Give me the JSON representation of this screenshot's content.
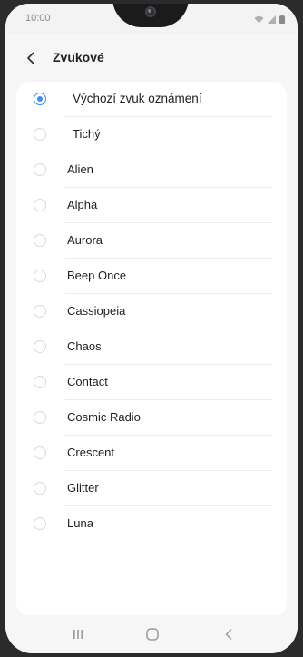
{
  "status_bar": {
    "time": "10:00"
  },
  "header": {
    "title": "Zvukové",
    "back_icon": "chevron-left-icon"
  },
  "sounds": [
    {
      "label": "Výchozí zvuk oznámení",
      "selected": true
    },
    {
      "label": "Tichý",
      "selected": false
    },
    {
      "label": "Alien",
      "selected": false
    },
    {
      "label": "Alpha",
      "selected": false
    },
    {
      "label": "Aurora",
      "selected": false
    },
    {
      "label": "Beep Once",
      "selected": false
    },
    {
      "label": "Cassiopeia",
      "selected": false
    },
    {
      "label": "Chaos",
      "selected": false
    },
    {
      "label": "Contact",
      "selected": false
    },
    {
      "label": "Cosmic Radio",
      "selected": false
    },
    {
      "label": "Crescent",
      "selected": false
    },
    {
      "label": "Glitter",
      "selected": false
    },
    {
      "label": "Luna",
      "selected": false
    }
  ],
  "nav_bar": {
    "icons": [
      "recent-apps-icon",
      "home-icon",
      "back-icon"
    ]
  },
  "colors": {
    "accent": "#3c8ef0",
    "background": "#f6f6f6",
    "card": "#ffffff"
  }
}
